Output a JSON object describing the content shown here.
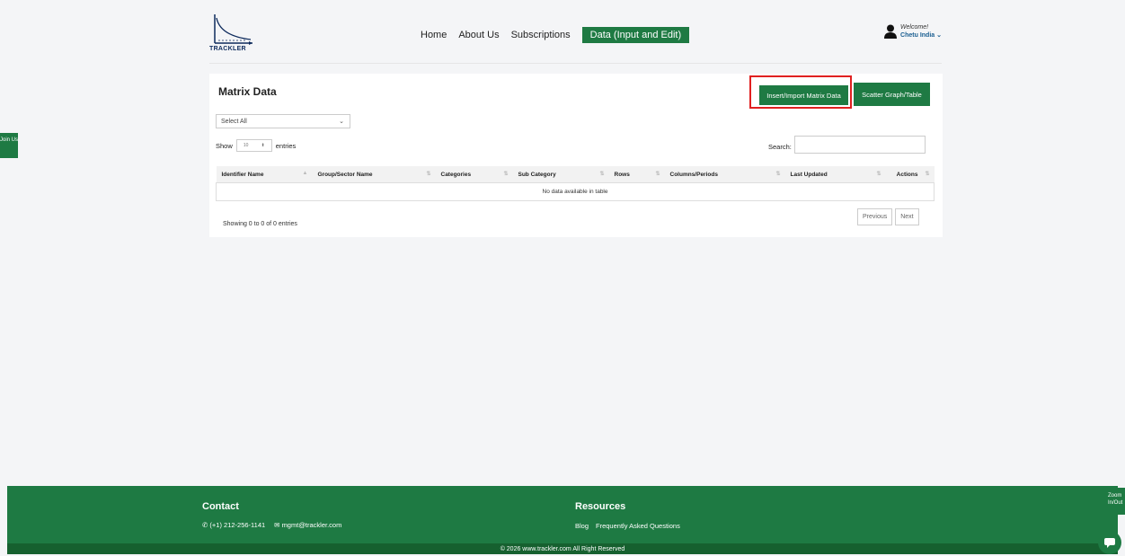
{
  "brand": {
    "logo_text": "TRACKLER"
  },
  "nav": {
    "items": [
      "Home",
      "About Us",
      "Subscriptions",
      "Data (Input and Edit)"
    ]
  },
  "user": {
    "welcome": "Welcome!",
    "name": "Chetu India"
  },
  "side": {
    "join_label": "Join Us",
    "zoom_label": "Zoom In/Out"
  },
  "card": {
    "title": "Matrix Data",
    "insert_button": "Insert/Import Matrix Data",
    "scatter_button": "Scatter Graph/Table",
    "select_value": "Select All",
    "show_label": "Show",
    "length_value": "10",
    "entries_label": "entries",
    "search_label": "Search:"
  },
  "table": {
    "columns": [
      "Identifier Name",
      "Group/Sector Name",
      "Categories",
      "Sub Category",
      "Rows",
      "Columns/Periods",
      "Last Updated",
      "Actions"
    ],
    "empty_message": "No data available in table",
    "info": "Showing 0 to 0 of 0 entries",
    "prev_label": "Previous",
    "next_label": "Next"
  },
  "footer": {
    "contact_title": "Contact",
    "phone": "(+1) 212-256-1141",
    "email": "mgmt@trackler.com",
    "resources_title": "Resources",
    "links": [
      "Blog",
      "Frequently Asked Questions"
    ],
    "copyright": "© 2026 www.trackler.com All Right Reserved"
  },
  "colors": {
    "primary_green": "#1e7a43",
    "highlight_red": "#e02020"
  }
}
